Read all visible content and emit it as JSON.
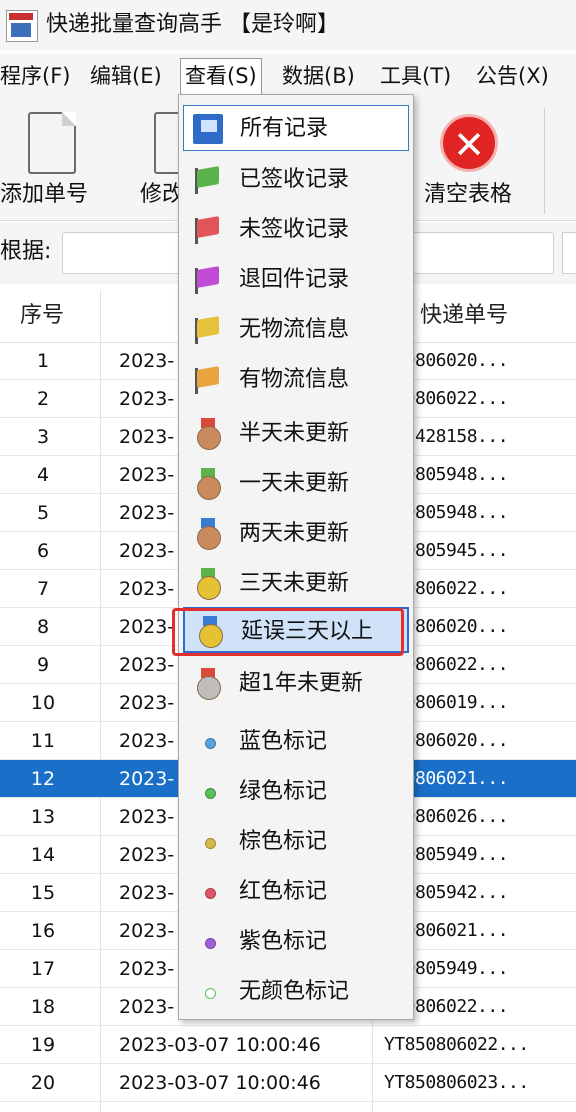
{
  "window": {
    "title": "快递批量查询高手 【是玲啊】"
  },
  "menu": [
    "程序(F)",
    "编辑(E)",
    "查看(S)",
    "数据(B)",
    "工具(T)",
    "公告(X)"
  ],
  "toolbar": {
    "add": "添加单号",
    "edit": "修改",
    "clear": "清空表格"
  },
  "filter": {
    "label": "根据:",
    "value": ""
  },
  "table": {
    "headers": {
      "no": "序号",
      "track": "快递单号"
    },
    "rows": [
      {
        "no": "1",
        "time": "2023-",
        "track": "850806020..."
      },
      {
        "no": "2",
        "time": "2023-",
        "track": "850806022..."
      },
      {
        "no": "3",
        "time": "2023-",
        "track": "895428158..."
      },
      {
        "no": "4",
        "time": "2023-",
        "track": "850805948..."
      },
      {
        "no": "5",
        "time": "2023-",
        "track": "850805948..."
      },
      {
        "no": "6",
        "time": "2023-",
        "track": "850805945..."
      },
      {
        "no": "7",
        "time": "2023-",
        "track": "850806022..."
      },
      {
        "no": "8",
        "time": "2023-",
        "track": "850806020..."
      },
      {
        "no": "9",
        "time": "2023-",
        "track": "850806022..."
      },
      {
        "no": "10",
        "time": "2023-",
        "track": "850806019..."
      },
      {
        "no": "11",
        "time": "2023-",
        "track": "850806020..."
      },
      {
        "no": "12",
        "time": "2023-",
        "track": "850806021..."
      },
      {
        "no": "13",
        "time": "2023-",
        "track": "850806026..."
      },
      {
        "no": "14",
        "time": "2023-",
        "track": "850805949..."
      },
      {
        "no": "15",
        "time": "2023-",
        "track": "850805942..."
      },
      {
        "no": "16",
        "time": "2023-",
        "track": "850806021..."
      },
      {
        "no": "17",
        "time": "2023-",
        "track": "850805949..."
      },
      {
        "no": "18",
        "time": "2023-",
        "track": "850806022..."
      },
      {
        "no": "19",
        "time": "2023-03-07  10:00:46",
        "track": "YT850806022..."
      },
      {
        "no": "20",
        "time": "2023-03-07  10:00:46",
        "track": "YT850806023..."
      }
    ],
    "selected_row": "12"
  },
  "view_menu": {
    "items": [
      {
        "label": "所有记录",
        "icon": "all-records-icon"
      },
      {
        "label": "已签收记录",
        "icon": "green-flag-icon",
        "color": "#5bb34a"
      },
      {
        "label": "未签收记录",
        "icon": "red-flag-icon",
        "color": "#e0545a"
      },
      {
        "label": "退回件记录",
        "icon": "purple-flag-icon",
        "color": "#c24bd6"
      },
      {
        "label": "无物流信息",
        "icon": "yellow-flag-icon",
        "color": "#e8c23a"
      },
      {
        "label": "有物流信息",
        "icon": "orange-flag-icon",
        "color": "#e9a441"
      },
      {
        "label": "半天未更新",
        "icon": "bronze-medal-icon",
        "color": "#c98a5e",
        "ribbon": "#d94a3d"
      },
      {
        "label": "一天未更新",
        "icon": "bronze-medal-icon",
        "color": "#c98a5e",
        "ribbon": "#5bb34a"
      },
      {
        "label": "两天未更新",
        "icon": "bronze-medal-icon",
        "color": "#c98a5e",
        "ribbon": "#3b7bd4"
      },
      {
        "label": "三天未更新",
        "icon": "gold-medal-icon",
        "color": "#e4c233",
        "ribbon": "#5bb34a"
      },
      {
        "label": "延误三天以上",
        "icon": "gold-medal-icon",
        "color": "#e4c233",
        "ribbon": "#3b7bd4"
      },
      {
        "label": "超1年未更新",
        "icon": "silver-medal-icon",
        "color": "#bdbdbd",
        "ribbon": "#d94a3d"
      },
      {
        "label": "蓝色标记",
        "icon": "blue-dot-icon",
        "color": "#5aa3e0"
      },
      {
        "label": "绿色标记",
        "icon": "green-dot-icon",
        "color": "#5bbf5a"
      },
      {
        "label": "棕色标记",
        "icon": "brown-dot-icon",
        "color": "#d6b84a"
      },
      {
        "label": "红色标记",
        "icon": "red-dot-icon",
        "color": "#e0546a"
      },
      {
        "label": "紫色标记",
        "icon": "purple-dot-icon",
        "color": "#a060d8"
      },
      {
        "label": "无颜色标记",
        "icon": "empty-dot-icon",
        "color": "#ffffff"
      }
    ],
    "highlighted": "延误三天以上"
  }
}
